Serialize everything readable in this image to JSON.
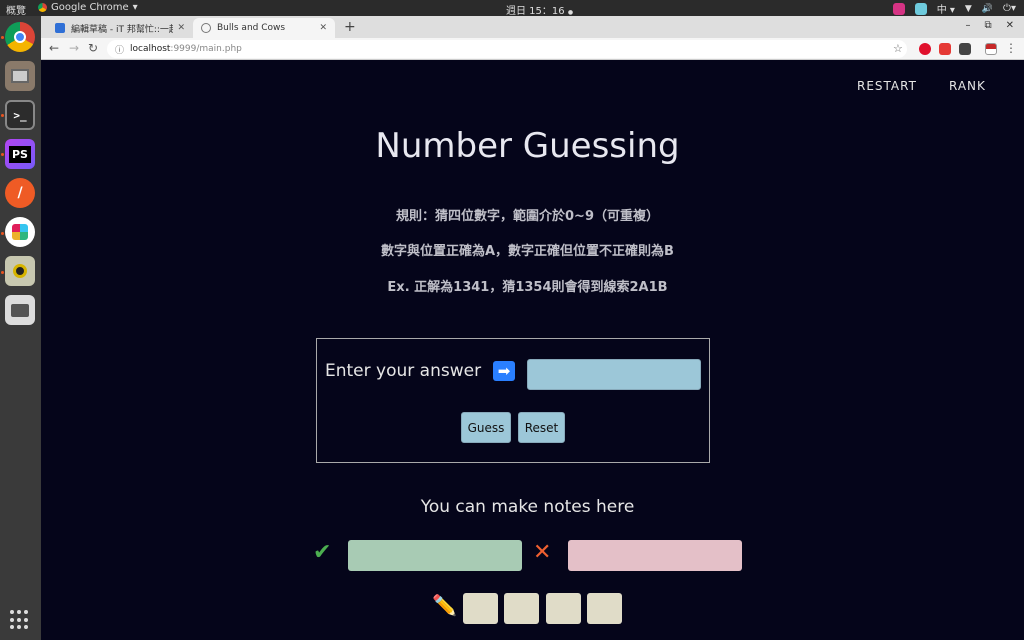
{
  "topbar": {
    "activities": "概覽",
    "app_name": "Google Chrome",
    "clock": "週日 15：16",
    "clock_dot": "●",
    "input_method": "中",
    "app_menu_arrow": "▾",
    "ime_arrow": "▾",
    "tray_menu": "▾",
    "tray_volume": "🔊",
    "tray_power": "⏻"
  },
  "browser": {
    "tabs": [
      {
        "label": "編輯草稿 - iT 邦幫忙::一起",
        "close": "✕"
      },
      {
        "label": "Bulls and Cows",
        "close": "✕"
      }
    ],
    "new_tab": "+",
    "url_host": "localhost",
    "url_path": ":9999/main.php",
    "info_icon": "ⓘ",
    "back": "←",
    "forward": "→",
    "reload": "↻",
    "star": "☆",
    "window_controls": {
      "minimize": "–",
      "restore": "⧉",
      "close": "✕"
    },
    "colors": {
      "tabstrip": "#dedede",
      "toolbar": "#f5f5f5"
    }
  },
  "page": {
    "nav": {
      "restart": "RESTART",
      "rank": "RANK"
    },
    "title": "Number Guessing",
    "rules": [
      "規則：猜四位數字，範圍介於0~9（可重複）",
      "數字與位置正確為A，數字正確但位置不正確則為B",
      "Ex. 正解為1341，猜1354則會得到線索2A1B"
    ],
    "answer": {
      "label": "Enter your answer",
      "arrow": "➡",
      "input_value": "",
      "guess_button": "Guess",
      "reset_button": "Reset"
    },
    "notes": {
      "title": "You can make notes here",
      "check_icon": "✔",
      "cross_icon": "✕",
      "pencil_icon": "✏️",
      "correct_value": "",
      "wrong_value": "",
      "digits": [
        "",
        "",
        "",
        ""
      ]
    },
    "colors": {
      "background": "#05051a",
      "input": "#9cc7d8",
      "correct_note": "#a8cbb4",
      "wrong_note": "#e4c0c8",
      "digit_box": "#e0dcc8",
      "check": "#4caf50",
      "cross": "#f06030"
    }
  }
}
